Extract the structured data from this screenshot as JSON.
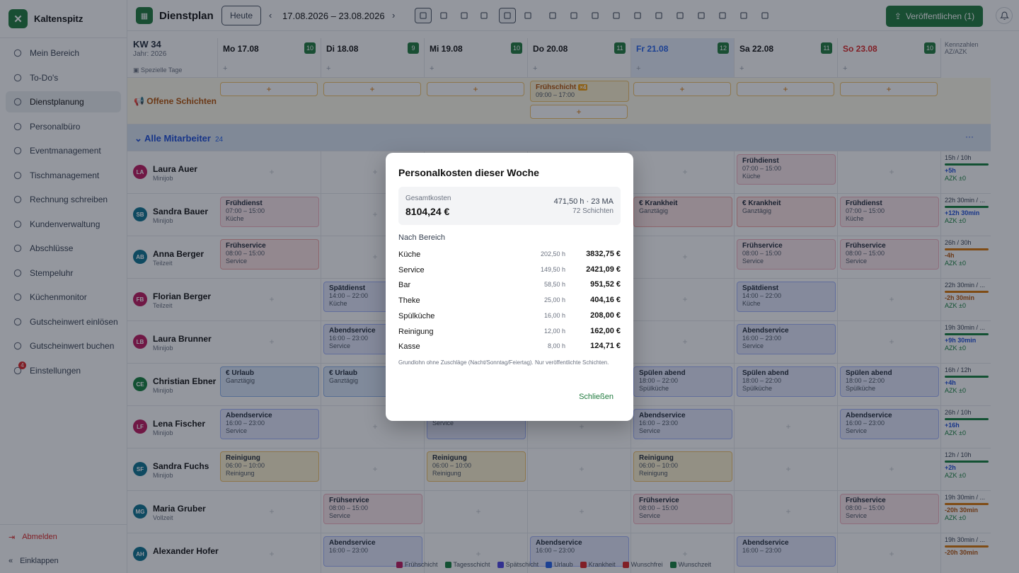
{
  "app": {
    "name": "Kaltenspitz"
  },
  "sidebar": {
    "items": [
      {
        "label": "Mein Bereich",
        "icon": "user-icon"
      },
      {
        "label": "To-Do's",
        "icon": "check-circle-icon"
      },
      {
        "label": "Dienstplanung",
        "icon": "calendar-icon",
        "active": true
      },
      {
        "label": "Personalbüro",
        "icon": "id-card-icon"
      },
      {
        "label": "Eventmanagement",
        "icon": "event-icon"
      },
      {
        "label": "Tischmanagement",
        "icon": "table-icon"
      },
      {
        "label": "Rechnung schreiben",
        "icon": "invoice-icon"
      },
      {
        "label": "Kundenverwaltung",
        "icon": "users-icon"
      },
      {
        "label": "Abschlüsse",
        "icon": "chart-icon"
      },
      {
        "label": "Stempeluhr",
        "icon": "clock-icon"
      },
      {
        "label": "Küchenmonitor",
        "icon": "cutlery-icon"
      },
      {
        "label": "Gutscheinwert einlösen",
        "icon": "gift-icon"
      },
      {
        "label": "Gutscheinwert buchen",
        "icon": "gift-box-icon"
      },
      {
        "label": "Einstellungen",
        "icon": "gear-icon",
        "badge": "4"
      }
    ],
    "logout": "Abmelden",
    "collapse": "Einklappen"
  },
  "toolbar": {
    "title": "Dienstplan",
    "today": "Heute",
    "range": "17.08.2026 – 23.08.2026",
    "publish": "Veröffentlichen (1)"
  },
  "week": {
    "kw": "KW 34",
    "year": "Jahr: 2026",
    "special": "Spezielle Tage",
    "kennzahlen": "Kennzahlen",
    "azk": "AZ/AZK",
    "days": [
      {
        "label": "Mo 17.08",
        "count": "10"
      },
      {
        "label": "Di 18.08",
        "count": "9"
      },
      {
        "label": "Mi 19.08",
        "count": "10"
      },
      {
        "label": "Do 20.08",
        "count": "11"
      },
      {
        "label": "Fr 21.08",
        "count": "12"
      },
      {
        "label": "Sa 22.08",
        "count": "11"
      },
      {
        "label": "So 23.08",
        "count": "10"
      }
    ]
  },
  "open_shifts": {
    "label": "Offene Schichten",
    "shift_title": "Frühschicht",
    "shift_badge": "×4",
    "shift_time": "09:00 – 17:00"
  },
  "group": {
    "label": "Alle Mitarbeiter",
    "count": "24"
  },
  "employees": [
    {
      "initials": "LA",
      "name": "Laura Auer",
      "type": "Minijob",
      "color": "#be185d",
      "shifts": [
        null,
        null,
        null,
        null,
        null,
        {
          "t": "Frühdienst",
          "time": "07:00 – 15:00",
          "area": "Küche",
          "c": "sh-pink"
        },
        null
      ],
      "kz": {
        "ratio": "15h / 10h",
        "delta": "+5h",
        "azk": "AZK ±0",
        "up": true
      }
    },
    {
      "initials": "SB",
      "name": "Sandra Bauer",
      "type": "Minijob",
      "color": "#0e7490",
      "shifts": [
        {
          "t": "Frühdienst",
          "time": "07:00 – 15:00",
          "area": "Küche",
          "c": "sh-pink"
        },
        null,
        null,
        null,
        {
          "t": "€ Krankheit",
          "time": "Ganztägig",
          "area": "",
          "c": "sh-red"
        },
        {
          "t": "€ Krankheit",
          "time": "Ganztägig",
          "area": "",
          "c": "sh-red"
        },
        {
          "t": "Frühdienst",
          "time": "07:00 – 15:00",
          "area": "Küche",
          "c": "sh-pink"
        }
      ],
      "kz": {
        "ratio": "22h 30min / ...",
        "delta": "+12h 30min",
        "azk": "AZK ±0",
        "up": true
      }
    },
    {
      "initials": "AB",
      "name": "Anna Berger",
      "type": "Teilzeit",
      "color": "#0e7490",
      "shifts": [
        {
          "t": "Frühservice",
          "time": "08:00 – 15:00",
          "area": "Service",
          "c": "sh-red"
        },
        null,
        null,
        null,
        null,
        {
          "t": "Frühservice",
          "time": "08:00 – 15:00",
          "area": "Service",
          "c": "sh-pink"
        },
        {
          "t": "Frühservice",
          "time": "08:00 – 15:00",
          "area": "Service",
          "c": "sh-pink"
        }
      ],
      "kz": {
        "ratio": "26h / 30h",
        "delta": "-4h",
        "azk": "AZK ±0",
        "up": false
      }
    },
    {
      "initials": "FB",
      "name": "Florian Berger",
      "type": "Teilzeit",
      "color": "#be185d",
      "shifts": [
        null,
        {
          "t": "Spätdienst",
          "time": "14:00 – 22:00",
          "area": "Küche",
          "c": "sh-blue"
        },
        null,
        null,
        null,
        {
          "t": "Spätdienst",
          "time": "14:00 – 22:00",
          "area": "Küche",
          "c": "sh-blue"
        },
        null
      ],
      "kz": {
        "ratio": "22h 30min / ...",
        "delta": "-2h 30min",
        "azk": "AZK ±0",
        "up": false
      }
    },
    {
      "initials": "LB",
      "name": "Laura Brunner",
      "type": "Minijob",
      "color": "#be185d",
      "shifts": [
        null,
        {
          "t": "Abendservice",
          "time": "16:00 – 23:00",
          "area": "Service",
          "c": "sh-blue"
        },
        null,
        null,
        null,
        {
          "t": "Abendservice",
          "time": "16:00 – 23:00",
          "area": "Service",
          "c": "sh-blue"
        },
        null
      ],
      "kz": {
        "ratio": "19h 30min / ...",
        "delta": "+9h 30min",
        "azk": "AZK ±0",
        "up": true
      }
    },
    {
      "initials": "CE",
      "name": "Christian Ebner",
      "type": "Minijob",
      "color": "#15803d",
      "shifts": [
        {
          "t": "€ Urlaub",
          "time": "Ganztägig",
          "area": "",
          "c": "sh-vac"
        },
        {
          "t": "€ Urlaub",
          "time": "Ganztägig",
          "area": "",
          "c": "sh-vac"
        },
        null,
        null,
        {
          "t": "Spülen abend",
          "time": "18:00 – 22:00",
          "area": "Spülküche",
          "c": "sh-blue"
        },
        {
          "t": "Spülen abend",
          "time": "18:00 – 22:00",
          "area": "Spülküche",
          "c": "sh-blue"
        },
        {
          "t": "Spülen abend",
          "time": "18:00 – 22:00",
          "area": "Spülküche",
          "c": "sh-blue"
        }
      ],
      "kz": {
        "ratio": "16h / 12h",
        "delta": "+4h",
        "azk": "AZK ±0",
        "up": true
      }
    },
    {
      "initials": "LF",
      "name": "Lena Fischer",
      "type": "Minijob",
      "color": "#be185d",
      "shifts": [
        {
          "t": "Abendservice",
          "time": "16:00 – 23:00",
          "area": "Service",
          "c": "sh-blue"
        },
        null,
        {
          "t": "",
          "time": "16:00 – 23:00",
          "area": "Service",
          "c": "sh-blue"
        },
        null,
        {
          "t": "Abendservice",
          "time": "16:00 – 23:00",
          "area": "Service",
          "c": "sh-blue"
        },
        null,
        {
          "t": "Abendservice",
          "time": "16:00 – 23:00",
          "area": "Service",
          "c": "sh-blue"
        }
      ],
      "kz": {
        "ratio": "26h / 10h",
        "delta": "+16h",
        "azk": "AZK ±0",
        "up": true
      }
    },
    {
      "initials": "SF",
      "name": "Sandra Fuchs",
      "type": "Minijob",
      "color": "#0e7490",
      "shifts": [
        {
          "t": "Reinigung",
          "time": "06:00 – 10:00",
          "area": "Reinigung",
          "c": "sh-yellow"
        },
        null,
        {
          "t": "Reinigung",
          "time": "06:00 – 10:00",
          "area": "Reinigung",
          "c": "sh-yellow"
        },
        null,
        {
          "t": "Reinigung",
          "time": "06:00 – 10:00",
          "area": "Reinigung",
          "c": "sh-yellow"
        },
        null,
        null
      ],
      "kz": {
        "ratio": "12h / 10h",
        "delta": "+2h",
        "azk": "AZK ±0",
        "up": true
      }
    },
    {
      "initials": "MG",
      "name": "Maria Gruber",
      "type": "Vollzeit",
      "color": "#0e7490",
      "shifts": [
        null,
        {
          "t": "Frühservice",
          "time": "08:00 – 15:00",
          "area": "Service",
          "c": "sh-pink"
        },
        null,
        null,
        {
          "t": "Frühservice",
          "time": "08:00 – 15:00",
          "area": "Service",
          "c": "sh-pink"
        },
        null,
        {
          "t": "Frühservice",
          "time": "08:00 – 15:00",
          "area": "Service",
          "c": "sh-pink"
        }
      ],
      "kz": {
        "ratio": "19h 30min / ...",
        "delta": "-20h 30min",
        "azk": "AZK ±0",
        "up": false
      }
    },
    {
      "initials": "AH",
      "name": "Alexander Hofer",
      "type": "",
      "color": "#0e7490",
      "shifts": [
        null,
        {
          "t": "Abendservice",
          "time": "16:00 – 23:00",
          "area": "",
          "c": "sh-blue"
        },
        null,
        {
          "t": "Abendservice",
          "time": "16:00 – 23:00",
          "area": "",
          "c": "sh-blue"
        },
        null,
        {
          "t": "Abendservice",
          "time": "16:00 – 23:00",
          "area": "",
          "c": "sh-blue"
        },
        null
      ],
      "kz": {
        "ratio": "19h 30min / ...",
        "delta": "-20h 30min",
        "azk": "",
        "up": false
      }
    }
  ],
  "legend": [
    "Frühschicht",
    "Tagesschicht",
    "Spätschicht",
    "Urlaub",
    "Krankheit",
    "Wunschfrei",
    "Wunschzeit"
  ],
  "modal": {
    "title": "Personalkosten dieser Woche",
    "total_label": "Gesamtkosten",
    "total_value": "8104,24 €",
    "total_hours": "471,50 h · 23 MA",
    "total_shifts": "72 Schichten",
    "section": "Nach Bereich",
    "rows": [
      {
        "name": "Küche",
        "hours": "202,50 h",
        "cost": "3832,75 €"
      },
      {
        "name": "Service",
        "hours": "149,50 h",
        "cost": "2421,09 €"
      },
      {
        "name": "Bar",
        "hours": "58,50 h",
        "cost": "951,52 €"
      },
      {
        "name": "Theke",
        "hours": "25,00 h",
        "cost": "404,16 €"
      },
      {
        "name": "Spülküche",
        "hours": "16,00 h",
        "cost": "208,00 €"
      },
      {
        "name": "Reinigung",
        "hours": "12,00 h",
        "cost": "162,00 €"
      },
      {
        "name": "Kasse",
        "hours": "8,00 h",
        "cost": "124,71 €"
      }
    ],
    "note": "Grundlohn ohne Zuschläge (Nacht/Sonntag/Feiertag). Nur veröffentlichte Schichten.",
    "close": "Schließen"
  },
  "colors": {
    "brand": "#1f7a3d",
    "friday": "#2563eb",
    "sunday": "#dc2626"
  }
}
